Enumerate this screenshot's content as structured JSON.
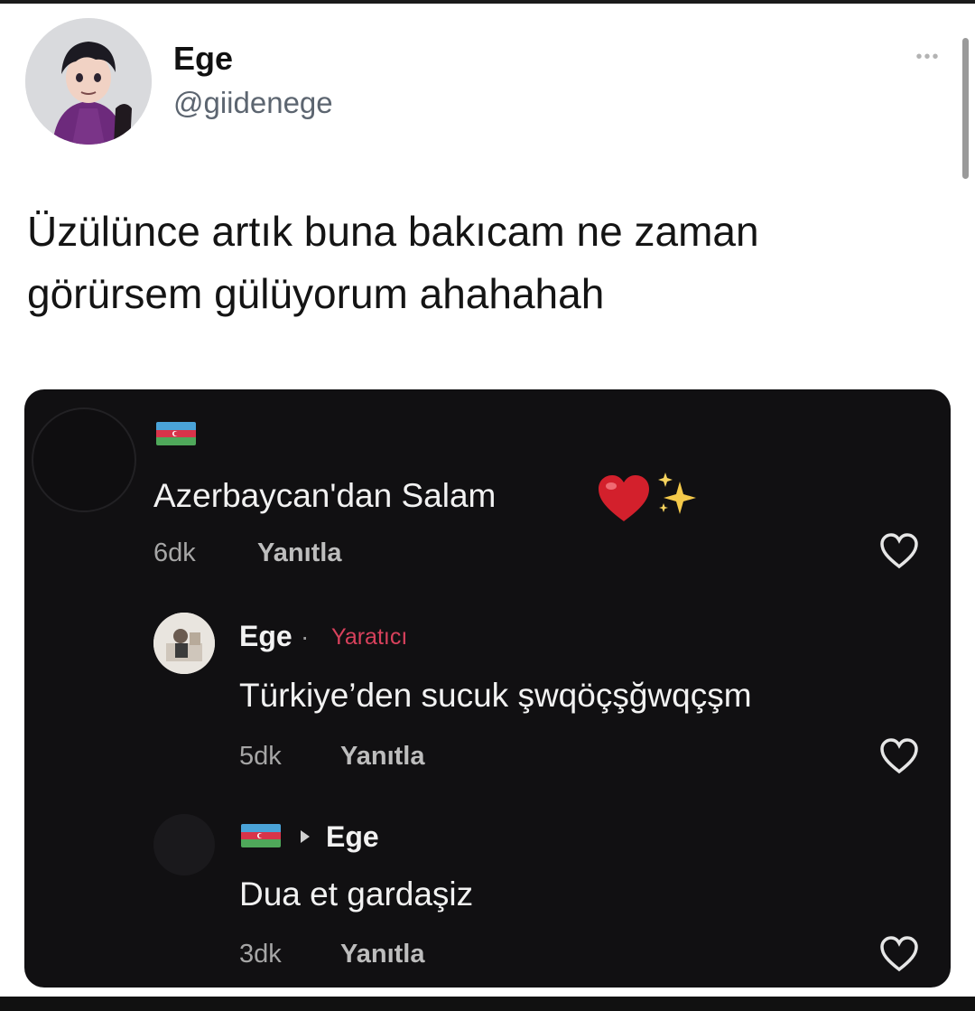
{
  "tweet": {
    "author_name": "Ege",
    "author_handle": "@giidenege",
    "more_label": "•••",
    "text_line1": "Üzülünce artık buna bakıcam ne zaman",
    "text_line2": "görürsem gülüyorum ahahahah"
  },
  "embedded_comments": [
    {
      "text": "Azerbaycan'dan Salam",
      "emoji": [
        "red-heart",
        "sparkles"
      ],
      "time": "6dk",
      "reply_label": "Yanıtla"
    },
    {
      "author": "Ege",
      "separator": "·",
      "creator_badge": "Yaratıcı",
      "text": "Türkiye’den sucuk şwqöçşğwqçşm",
      "time": "5dk",
      "reply_label": "Yanıtla"
    },
    {
      "reply_to": "Ege",
      "text": "Dua et gardaşiz",
      "time": "3dk",
      "reply_label": "Yanıtla"
    }
  ],
  "colors": {
    "embed_background": "#111012",
    "creator_badge": "#d8415c",
    "heart_emoji": "#d3202c",
    "handle": "#5c6570"
  },
  "icons": [
    "profile-avatar",
    "more-icon",
    "azerbaijan-flag-icon",
    "heart-outline-icon",
    "reply-arrow-icon",
    "red-heart-emoji",
    "sparkles-emoji"
  ]
}
